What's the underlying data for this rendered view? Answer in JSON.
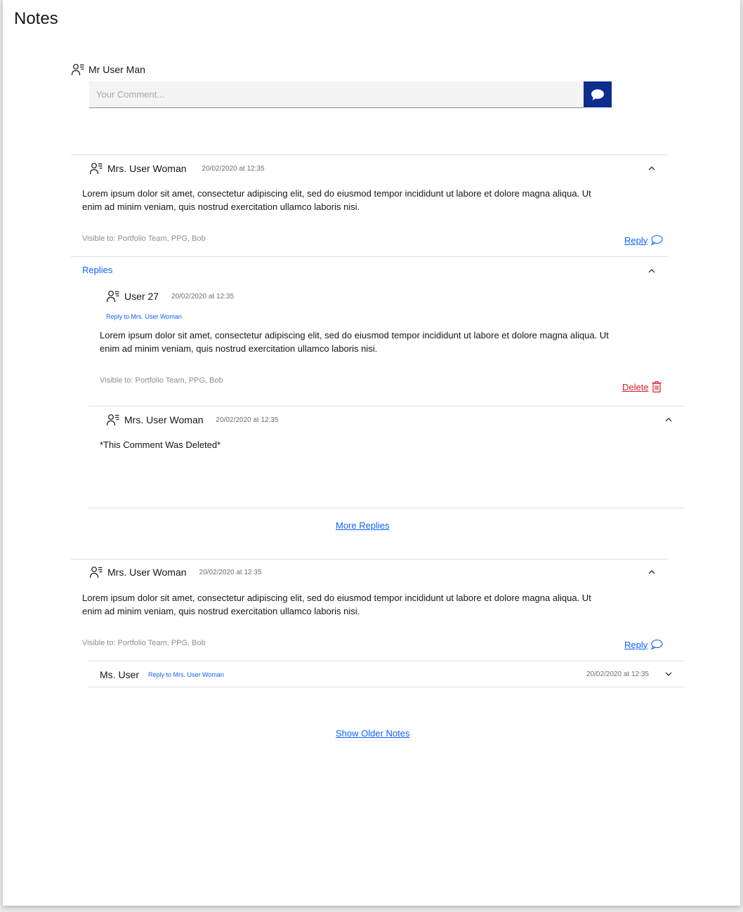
{
  "page": {
    "title": "Notes"
  },
  "composer": {
    "user_name": "Mr User Man",
    "placeholder": "Your Comment...",
    "send_icon": "speech-bubble-icon"
  },
  "notes": [
    {
      "author": "Mrs. User Woman",
      "timestamp": "20/02/2020 at 12:35",
      "text": "Lorem ipsum dolor sit amet, consectetur adipiscing elit, sed do eiusmod tempor incididunt ut labore et dolore magna aliqua. Ut enim ad minim veniam, quis nostrud exercitation ullamco laboris nisi.",
      "visible_to": "Visible to: Portfolio Team, PPG, Bob",
      "reply_label": "Reply",
      "replies_label": "Replies",
      "replies": [
        {
          "author": "User 27",
          "timestamp": "20/02/2020 at 12:35",
          "reply_to": "Reply to Mrs. User Woman",
          "text": "Lorem ipsum dolor sit amet, consectetur adipiscing elit, sed do eiusmod tempor incididunt ut labore et dolore magna aliqua. Ut enim ad minim veniam, quis nostrud exercitation ullamco laboris nisi.",
          "visible_to": "Visible to: Portfolio Team, PPG, Bob",
          "delete_label": "Delete"
        },
        {
          "author": "Mrs. User Woman",
          "timestamp": "20/02/2020 at 12:35",
          "text": "*This Comment Was Deleted*"
        }
      ],
      "more_replies_label": "More Replies"
    },
    {
      "author": "Mrs. User Woman",
      "timestamp": "20/02/2020 at 12:35",
      "text": "Lorem ipsum dolor sit amet, consectetur adipiscing elit, sed do eiusmod tempor incididunt ut labore et dolore magna aliqua. Ut enim ad minim veniam, quis nostrud exercitation ullamco laboris nisi.",
      "visible_to": "Visible to: Portfolio Team, PPG, Bob",
      "reply_label": "Reply",
      "collapsed_reply": {
        "author": "Ms. User",
        "reply_to": "Reply to Mrs. User Woman",
        "timestamp": "20/02/2020 at 12:35"
      }
    }
  ],
  "show_older_label": "Show Older Notes",
  "colors": {
    "accent": "#0f62fe",
    "send_button": "#0f2d8f",
    "danger": "#da1e28",
    "divider": "#e0e0e0"
  }
}
